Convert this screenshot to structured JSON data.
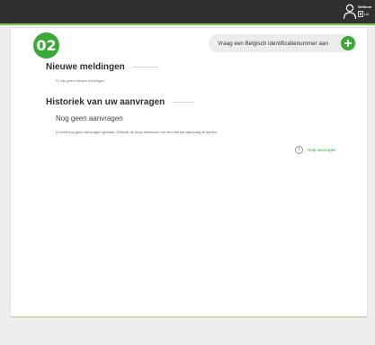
{
  "header": {
    "welcome_text": "Welkom",
    "logout_label": "Uit"
  },
  "step": {
    "number": "02"
  },
  "request_button": {
    "label": "Vraag een Belgisch identificatienummer aan"
  },
  "notifications": {
    "title": "Nieuwe meldingen",
    "empty_text": "Er zijn geen nieuwe meldingen"
  },
  "history": {
    "title": "Historiek van uw aanvragen",
    "empty_title": "Nog geen aanvragen",
    "empty_text": "U heeft nog geen aanvragen gedaan. Gebruik de knop hierboven om een nieuwe aanvraag te starten."
  },
  "help": {
    "icon_glyph": "i",
    "label": "Hulp aanvragen"
  },
  "colors": {
    "topbar": "#2e3031",
    "accent": "#3aa935",
    "background": "#eeeeee"
  },
  "icons": {
    "user": "user-icon",
    "logout": "logout-icon",
    "add": "plus-circle-icon",
    "help": "info-icon"
  }
}
